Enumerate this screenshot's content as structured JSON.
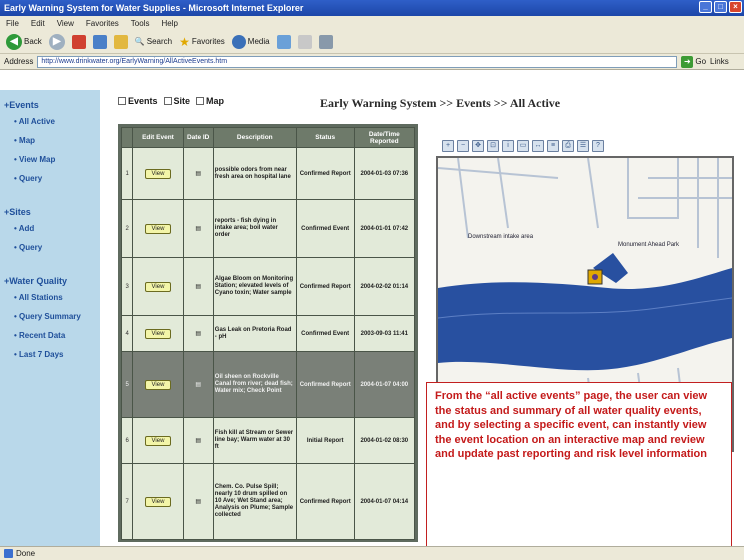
{
  "browser": {
    "title": "Early Warning System for Water Supplies - Microsoft Internet Explorer",
    "menu": [
      "File",
      "Edit",
      "View",
      "Favorites",
      "Tools",
      "Help"
    ],
    "toolbar": {
      "back": "Back",
      "search": "Search",
      "favorites": "Favorites",
      "media": "Media"
    },
    "address_label": "Address",
    "address_value": "http://www.drinkwater.org/EarlyWarning/AllActiveEvents.htm",
    "go_label": "Go",
    "links_label": "Links",
    "status_text": "Done"
  },
  "sidebar": {
    "sections": [
      {
        "title": "Events",
        "items": [
          "All Active",
          "Map",
          "View Map",
          "Query"
        ]
      },
      {
        "title": "Sites",
        "items": [
          "Add",
          "Query"
        ]
      },
      {
        "title": "Water Quality",
        "items": [
          "All Stations",
          "Query Summary",
          "Recent Data",
          "Last 7 Days"
        ]
      }
    ]
  },
  "content": {
    "tabs": [
      "Events",
      "Site",
      "Map"
    ],
    "heading": "Early Warning System >> Events >> All Active",
    "table": {
      "columns": [
        "Edit Event",
        "Date ID",
        "Description",
        "Status",
        "Date/Time Reported"
      ],
      "link_label": "View",
      "rows": [
        {
          "desc": "possible odors from near fresh area on hospital lane",
          "status": "Confirmed Report",
          "date": "2004-01-03 07:36"
        },
        {
          "desc": "reports - fish dying in intake area; boil water order",
          "status": "Confirmed Event",
          "date": "2004-01-01 07:42"
        },
        {
          "desc": "Algae Bloom on Monitoring Station; elevated levels of Cyano toxin; Water sample",
          "status": "Confirmed Report",
          "date": "2004-02-02 01:14"
        },
        {
          "desc": "Gas Leak on Pretoria Road - pH",
          "status": "Confirmed Event",
          "date": "2003-09-03 11:41"
        },
        {
          "desc": "Oil sheen on Rockville Canal from river; dead fish; Water mix; Check Point",
          "status": "Confirmed Report",
          "date": "2004-01-07 04:00"
        },
        {
          "desc": "Fish kill at Stream or Sewer line bay; Warm water at 30 ft",
          "status": "Initial Report",
          "date": "2004-01-02 08:30"
        },
        {
          "desc": "Chem. Co. Pulse Spill; nearly 10 drum spilled on 10 Ave; Wet Stand area; Analysis on Plume; Sample collected",
          "status": "Confirmed Report",
          "date": "2004-01-07 04:14"
        }
      ]
    },
    "map": {
      "labels": [
        "Downstream intake area",
        "Monument Ahead Park"
      ],
      "accent_water": "#2850a0",
      "accent_land": "#f4f3ee"
    },
    "callout": "From the “all active events” page, the user can view the status and summary of all water quality events, and by selecting a specific event, can instantly view the event location on an interactive map and review and update past reporting and risk level information"
  }
}
